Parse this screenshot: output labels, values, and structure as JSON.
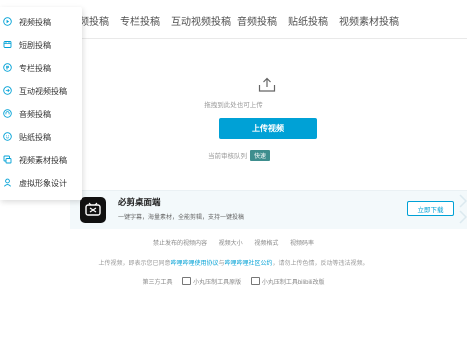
{
  "tabs": [
    "视频投稿",
    "专栏投稿",
    "互动视频投稿",
    "音频投稿",
    "贴纸投稿",
    "视频素材投稿"
  ],
  "sidebar": {
    "items": [
      {
        "label": "视频投稿",
        "icon": "video-play-icon"
      },
      {
        "label": "短剧投稿",
        "icon": "short-drama-icon"
      },
      {
        "label": "专栏投稿",
        "icon": "article-icon"
      },
      {
        "label": "互动视频投稿",
        "icon": "interactive-video-icon"
      },
      {
        "label": "音频投稿",
        "icon": "audio-icon"
      },
      {
        "label": "贴纸投稿",
        "icon": "sticker-icon"
      },
      {
        "label": "视频素材投稿",
        "icon": "material-icon"
      },
      {
        "label": "虚拟形象设计",
        "icon": "avatar-person-icon"
      }
    ]
  },
  "upload": {
    "hint": "拖拽到此处也可上传",
    "button_label": "上传视频",
    "queue_label": "当前审核队列",
    "queue_status": "快速"
  },
  "promo": {
    "title": "必剪桌面端",
    "subtitle": "一键字幕，海量素材，全能剪辑，支持一键投稿",
    "download_label": "立即下载"
  },
  "footer": {
    "links": [
      "禁止发布的视频内容",
      "视频大小",
      "视频格式",
      "视频码率"
    ],
    "agreement_prefix": "上传视频，即表示您已同意",
    "agreement_link1": "哔哩哔哩使用协议",
    "agreement_and": "与",
    "agreement_link2": "哔哩哔哩社区公约",
    "agreement_suffix": "，请勿上传色情，反动等违法视频。",
    "tools_label": "第三方工具",
    "tools": [
      "小丸压制工具原版",
      "小丸压制工具bilibili改版"
    ]
  },
  "colors": {
    "accent": "#00a1d6",
    "queue_badge": "#3e8e8e",
    "promo_bg": "#f3f9fb",
    "sidebar_icon": "#00a1d6"
  }
}
